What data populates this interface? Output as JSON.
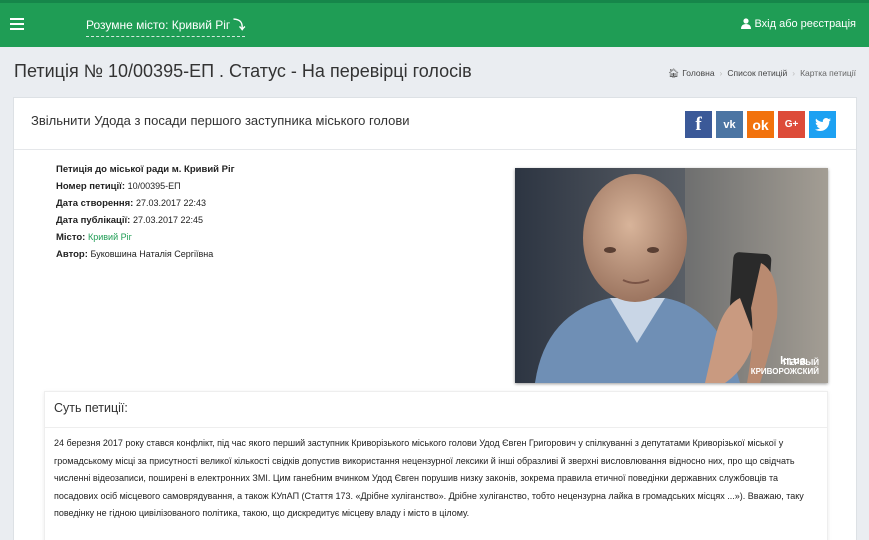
{
  "topbar": {
    "city_link": "Розумне місто: Кривий Ріг",
    "login_label": "Вхід або реєстрація",
    "brand_color": "#1f9d55"
  },
  "header": {
    "title": "Петиція № 10/00395-ЕП . Статус - На перевірці голосів",
    "breadcrumb": [
      "Головна",
      "Список петицій",
      "Картка петиції"
    ]
  },
  "petition": {
    "title": "Звільнити Удода з посади першого заступника міського голови",
    "share_icons": [
      "facebook-icon",
      "vk-icon",
      "odnoklassniki-icon",
      "google-plus-icon",
      "twitter-icon"
    ],
    "info": [
      {
        "label": "Петиція до міської ради м. Кривий Ріг",
        "value": ""
      },
      {
        "label": "Номер петиції:",
        "value": "10/00395-ЕП"
      },
      {
        "label": "Дата створення:",
        "value": "27.03.2017 22:43"
      },
      {
        "label": "Дата публікації:",
        "value": "27.03.2017 22:45"
      },
      {
        "label": "Місто:",
        "value": "Кривий Ріг"
      },
      {
        "label": "Автор:",
        "value": "Буковшина Наталія Сергіївна"
      }
    ],
    "photo_watermark": "kr.ua",
    "photo_caption_1": "ПЕРВЫЙ",
    "photo_caption_2": "КРИВОРОЖСКИЙ"
  },
  "essence": {
    "title": "Суть петиції:",
    "text": "24 березня 2017 року стався конфлікт, під час якого перший заступник Криворізького міського голови Удод Євген Григорович у спілкуванні з депутатами Криворізької міської у громадському місці за присутності великої кількості свідків допустив використання нецензурної лексики й інші образливі й зверхні висловлювання відносно них, про що свідчать численні відеозаписи, поширені в електронних ЗМІ. Цим ганебним вчинком Удод Євген порушив низку законів, зокрема правила етичної поведінки державних службовців та посадових осіб місцевого самоврядування, а також КУпАП (Стаття 173. «Дрібне хуліганство». Дрібне хуліганство, тобто нецензурна лайка в громадських місцях ...»). Вважаю, таку поведінку не гідною цивілізованого політика, такою, що дискредитує місцеву владу і місто в цілому."
  }
}
